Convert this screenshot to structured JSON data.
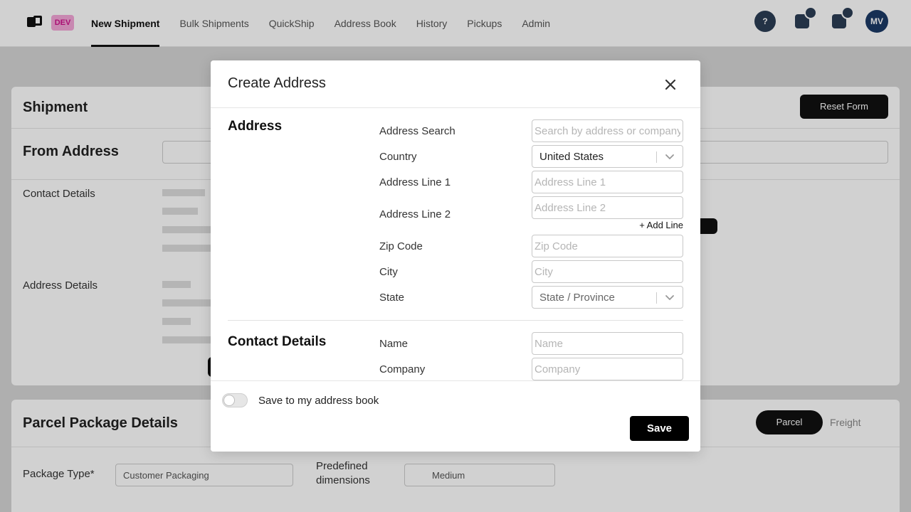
{
  "topbar": {
    "env_badge": "DEV",
    "nav": [
      {
        "label": "New Shipment",
        "active": true
      },
      {
        "label": "Bulk Shipments"
      },
      {
        "label": "QuickShip"
      },
      {
        "label": "Address Book"
      },
      {
        "label": "History"
      },
      {
        "label": "Pickups"
      },
      {
        "label": "Admin"
      }
    ],
    "avatar_initials": "MV"
  },
  "background": {
    "shipment_title": "Shipment",
    "reset_button": "Reset Form",
    "from_address_title": "From Address",
    "contact_details_title": "Contact Details",
    "address_details_title": "Address Details",
    "parcel_title": "Parcel Package Details",
    "parcel_tab": "Parcel",
    "freight_tab": "Freight",
    "package_type_label": "Package Type*",
    "package_type_value": "Customer Packaging",
    "predefined_label": "Predefined dimensions",
    "predefined_value": "Medium"
  },
  "modal": {
    "title": "Create Address",
    "sections": {
      "address": "Address",
      "contact": "Contact Details"
    },
    "fields": {
      "address_search": {
        "label": "Address Search",
        "placeholder": "Search by address or company"
      },
      "country": {
        "label": "Country",
        "value": "United States"
      },
      "address_line_1": {
        "label": "Address Line 1",
        "placeholder": "Address Line 1"
      },
      "address_line_2": {
        "label": "Address Line 2",
        "placeholder": "Address Line 2"
      },
      "add_line": "+ Add Line",
      "zip_code": {
        "label": "Zip Code",
        "placeholder": "Zip Code"
      },
      "city": {
        "label": "City",
        "placeholder": "City"
      },
      "state": {
        "label": "State",
        "placeholder": "State / Province"
      },
      "name": {
        "label": "Name",
        "placeholder": "Name"
      },
      "company": {
        "label": "Company",
        "placeholder": "Company"
      }
    },
    "footer": {
      "save_to_book_label": "Save to my address book",
      "save_to_book_on": false,
      "save_button": "Save"
    }
  },
  "colors": {
    "primary_button": "#000000",
    "overlay": "rgba(0,0,0,0.18)",
    "env_badge": "#f4a7d8"
  }
}
